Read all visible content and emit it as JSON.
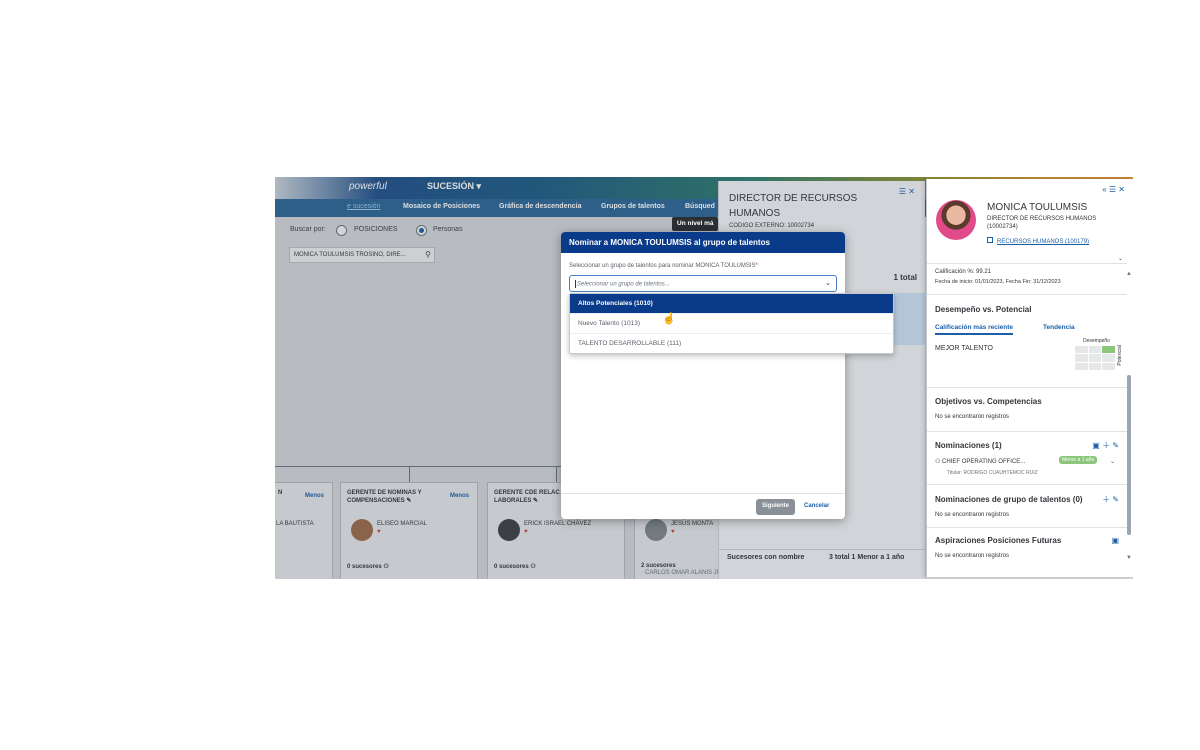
{
  "header": {
    "logo": "powerful",
    "module": "SUCESIÓN ▾",
    "nav_tabs": [
      "e sucesión",
      "Mosaico de Posiciones",
      "Gráfica de descendencia",
      "Grupos de talentos",
      "Búsqued"
    ]
  },
  "tooltip": "Un nivel má",
  "search": {
    "label": "Buscar por:",
    "option_positions": "POSICIONES",
    "option_people": "Personas",
    "value": "MONICA TOULUMSIS TROSINO, DIRE...",
    "search_icon": "magnifier-icon"
  },
  "org_cards": [
    {
      "title": "N",
      "menos": "Menos",
      "person": "LA BAUTISTA",
      "successors": ""
    },
    {
      "title": "GERENTE DE NOMINAS Y COMPENSACIONES ✎",
      "menos": "Menos",
      "person": "ELISEO MARCIAL",
      "successors": "0 sucesores ⚇"
    },
    {
      "title": "GERENTE CDE RELAC LABORALES ✎",
      "menos": "",
      "person": "ERICK ISRAEL CHÁVEZ",
      "successors": "0 sucesores ⚇"
    },
    {
      "title": "",
      "menos": "",
      "person": "JESÚS MONTA",
      "successors": "2 sucesores"
    }
  ],
  "bottom_names": "CARLOS OMAR ALANIS          JUAN ANTONIO ACEVEDO          JESSICA ROA",
  "position_panel": {
    "title": "DIRECTOR DE RECURSOS HUMANOS",
    "code": "CODIGO EXTERNO: 10002734",
    "total": "1 total",
    "footer_label": "Sucesores con nombre",
    "footer_value": "3 total 1 Menor a 1 año",
    "icons": "☰ ✕"
  },
  "dialog": {
    "title": "Nominar a MONICA TOULUMSIS al grupo de talentos",
    "field_label": "Seleccionar un grupo de talentos para nominar MONICA TOULUMSIS",
    "required_mark": "*",
    "placeholder": "Seleccionar un grupo de talentos...",
    "options": [
      "Altos Potenciales (1010)",
      "Nuevo Talento (1013)",
      "TALENTO DESARROLLABLE (111)"
    ],
    "next_label": "Siguiente",
    "cancel_label": "Cancelar"
  },
  "profile": {
    "name": "MONICA TOULUMSIS",
    "role": "DIRECTOR DE RECURSOS HUMANOS (10002734)",
    "department": "RECURSOS HUMANOS (100179)",
    "rating": "Calificación %: 99.21",
    "dates": "Fecha de inicio: 01/01/2023, Fecha Fin: 31/12/2023",
    "perf_vs_pot": "Desempeño vs. Potencial",
    "tab_recent": "Calificación más reciente",
    "tab_trend": "Tendencia",
    "perf_result": "MEJOR TALENTO",
    "grid_top": "Desempeño",
    "grid_side": "Potencial",
    "objectives": "Objetivos vs. Competencias",
    "no_records": "No se encontraron registros",
    "nominations": "Nominaciones (1)",
    "nomination_position": "CHIEF OPERATING OFFICE...",
    "nomination_badge": "Menor a 1 año",
    "titular": "Titular: RODRIGO CUAUHTEMOC RUIZ",
    "talent_nominations": "Nominaciones de grupo de talentos (0)",
    "future_aspirations": "Aspiraciones Posiciones Futuras",
    "header_icons": "« ☰ ✕"
  },
  "colors": {
    "dialog_header": "#0a3a8a",
    "link": "#1c5ea8",
    "badge": "#8cc67a"
  }
}
